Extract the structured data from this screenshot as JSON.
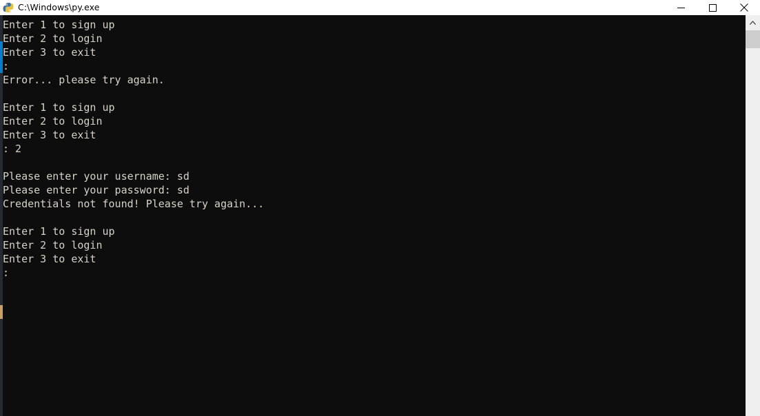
{
  "window": {
    "title": "C:\\Windows\\py.exe",
    "icon": "python-logo-icon",
    "background_color": "#0d0d0d",
    "titlebar_color": "#ffffff",
    "text_color": "#d8d3c8"
  },
  "window_controls": [
    {
      "name": "minimize",
      "glyph": "minimize-icon",
      "label": "Minimize"
    },
    {
      "name": "maximize",
      "glyph": "maximize-icon",
      "label": "Maximize"
    },
    {
      "name": "close",
      "glyph": "close-icon",
      "label": "Close"
    }
  ],
  "console": {
    "lines": [
      "Enter 1 to sign up",
      "Enter 2 to login",
      "Enter 3 to exit",
      ":",
      "Error... please try again.",
      "",
      "Enter 1 to sign up",
      "Enter 2 to login",
      "Enter 3 to exit",
      ": 2",
      "",
      "Please enter your username: sd",
      "Please enter your password: sd",
      "Credentials not found! Please try again...",
      "",
      "Enter 1 to sign up",
      "Enter 2 to login",
      "Enter 3 to exit",
      ":"
    ],
    "text": "Enter 1 to sign up\nEnter 2 to login\nEnter 3 to exit\n:\nError... please try again.\n\nEnter 1 to sign up\nEnter 2 to login\nEnter 3 to exit\n: 2\n\nPlease enter your username: sd\nPlease enter your password: sd\nCredentials not found! Please try again...\n\nEnter 1 to sign up\nEnter 2 to login\nEnter 3 to exit\n:",
    "menu_options": [
      "Enter 1 to sign up",
      "Enter 2 to login",
      "Enter 3 to exit"
    ],
    "prompt_symbol": ":",
    "entered_choice": "2",
    "username_prompt": "Please enter your username: ",
    "username_value": "sd",
    "password_prompt": "Please enter your password: ",
    "password_value": "sd",
    "error_messages": [
      "Error... please try again.",
      "Credentials not found! Please try again..."
    ]
  },
  "scrollbar": {
    "up_arrow": "chevron-up-icon",
    "thumb_color": "#cdcdcd",
    "track_color": "#efefef"
  }
}
